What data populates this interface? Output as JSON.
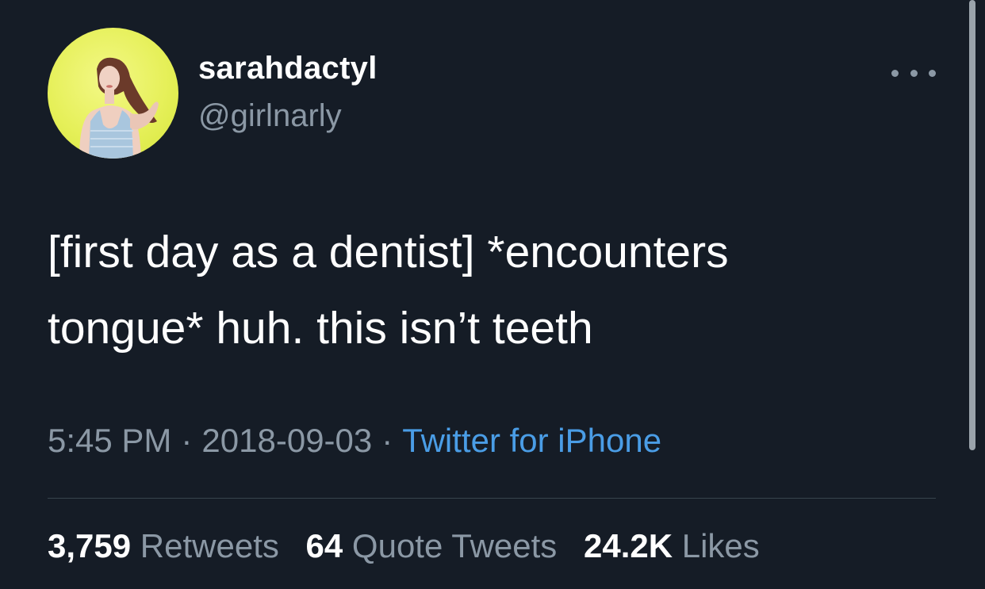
{
  "tweet": {
    "display_name": "sarahdactyl",
    "handle": "@girlnarly",
    "text_line1": "[first day as a dentist] *encounters",
    "text_line2": "tongue* huh. this isn’t teeth",
    "time": "5:45 PM",
    "date": "2018-09-03",
    "separator": "·",
    "source": "Twitter for iPhone"
  },
  "stats": {
    "retweets_count": "3,759",
    "retweets_label": "Retweets",
    "quotes_count": "64",
    "quotes_label": "Quote Tweets",
    "likes_count": "24.2K",
    "likes_label": "Likes"
  },
  "icons": {
    "more": "more-horizontal-icon"
  },
  "colors": {
    "background": "#151c26",
    "primary_text": "#ffffff",
    "secondary_text": "#8b98a5",
    "link": "#4a9de6",
    "divider": "#38444d",
    "avatar_bg": "#e6f05a"
  }
}
